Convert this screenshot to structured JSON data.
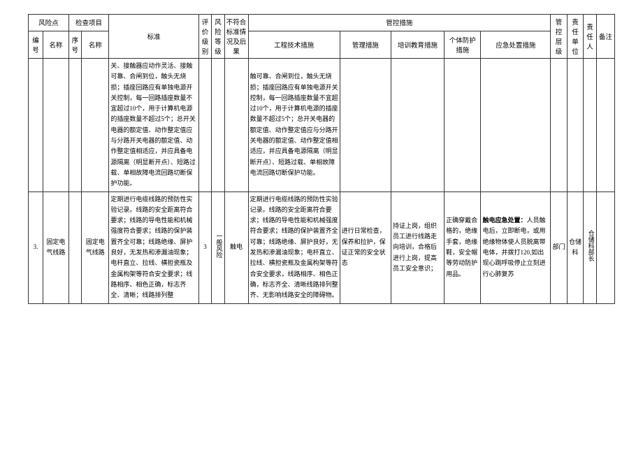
{
  "headers": {
    "group_fengxiandian": "风险点",
    "group_jianchaxiangmu": "检查项目",
    "group_biaozhun": "标准",
    "group_pingjiajiebie": "评价级别",
    "group_fengxiandengji": "风险等级",
    "group_bufuhe": "不符合标准情况及后果",
    "group_guankongcuoshi": "管控措施",
    "group_guankongcengji": "管控层级",
    "group_zerendanwei": "责任单位",
    "group_zerenren": "责任人",
    "group_beizhu": "备注",
    "col_bianhao": "编号",
    "col_mingcheng": "名称",
    "col_xuhao": "序号",
    "col_jianchamc": "名称",
    "col_gongcheng": "工程技术措施",
    "col_guanli": "管理措施",
    "col_peixun": "培训教育措施",
    "col_getifanghu": "个体防护措施",
    "col_yingji": "应急处置措施"
  },
  "row1": {
    "biaozhun": "关、接触器应动作灵活、接触可靠、合闸到位，触头无烧损；插座回路应有单独电源开关控制，每一回路插座数量不宜超过10个，用于计算机电源的插座数量不超过5个；总开关电器的额定值、动作整定值应与分路开关电器的额定值、动作整定值相适应，并应具备电源隔离（明显断开点）、短路过载、单相故障电流回路切断保护功能。",
    "gongcheng": "触可靠、合闸到位，触头无烧损；插座回路应有单独电源开关控制，每一回路插座数量不宜超过10个，用于计算机电源的插座数量不超过5个；总开关电器的额定值、动作整定值应与分路开关电器的额定值、动作整定值相适应，并应具备电源隔离（明显断开点）、短路过载、单相故障电流回路切断保护功能。"
  },
  "row2": {
    "bianhao": "3.",
    "fxd_mingcheng": "固定电气线路",
    "jc_mingcheng": "固定电气线路",
    "biaozhun": "定期进行电缆线路的预防性实验记录。线路的安全距离符合要求；线路的导电性能和机械强度符合要求；线路的保护装置齐全可靠；线路绝缘、屏护良好，无发热和渗漏油现象；电杆直立、拉线、横担瓷瓶及金属构架等符合安全要求；线路相序、相色正确，标志齐全、清晰；线路排列整",
    "pjjb": "3",
    "fxdj": "一般风险",
    "bfh": "触电",
    "gongcheng": "定期进行电缆线路的预防性实验记录。线路的安全距离符合要求；线路的导电性能和机械强度符合要求；线路的保护装置齐全可靠；线路绝缘、屏护良好，无发热和渗漏油现象；电杆直立、拉线、横担瓷瓶及金属构架等符合安全要求，线路相序、相色正确，标志齐全、清晰线路排列整齐、无影响线路安全的障碍物。",
    "guanli": "进行日常检查，保养和拉护，保证正常的安全状态",
    "peixun": "持证上岗，组织员工进行线路走向培训，合格后进行上岗，提高员工安全意识；",
    "getifanghu": "正确穿戴合格的，绝缘手套，绝缘鞋，安全帽等劳动防护用品。",
    "yingji_label": "触电应急处置：",
    "yingji": "人员触电后，立即断电，或用绝缘物体使人员脱离带电体，并拨打120,如出现心跳呼吸停止立刻进行心肺复苏",
    "gkcj": "部门",
    "zrdw": "仓储科",
    "zrr": "仓储科部长"
  }
}
